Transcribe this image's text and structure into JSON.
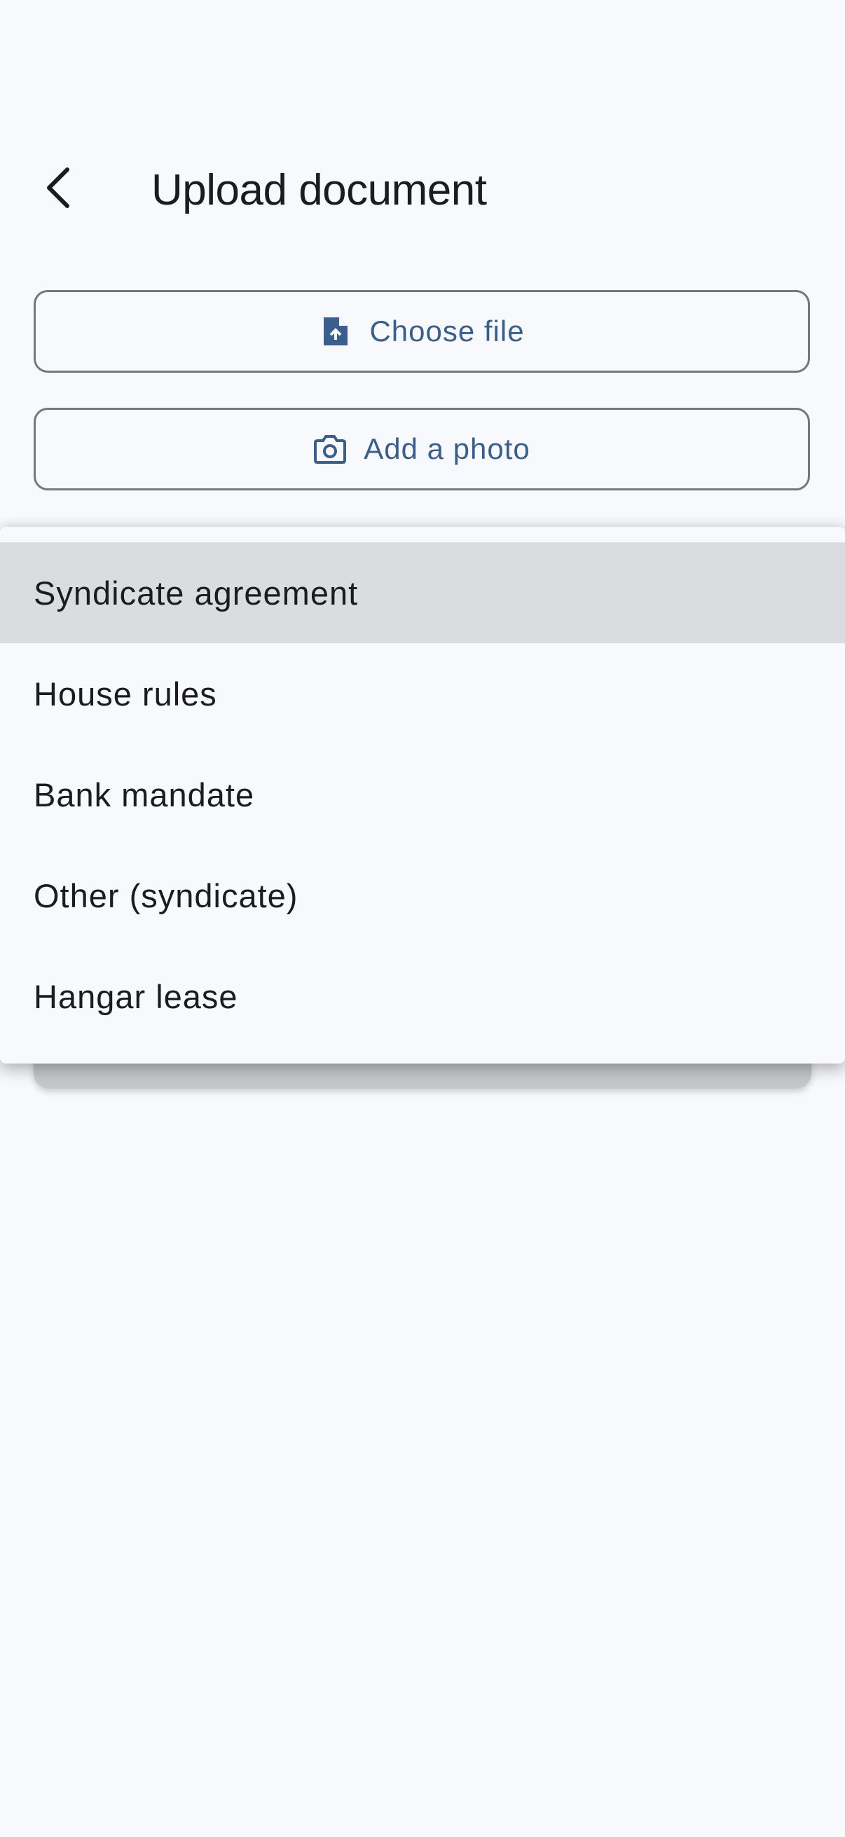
{
  "header": {
    "title": "Upload document",
    "back_icon": "chevron-left-icon"
  },
  "actions": {
    "choose_file_label": "Choose file",
    "choose_file_icon": "file-upload-icon",
    "add_photo_label": "Add a photo",
    "add_photo_icon": "camera-icon"
  },
  "dropdown": {
    "selected_index": 0,
    "options": [
      "Syndicate agreement",
      "House rules",
      "Bank mandate",
      "Other (syndicate)",
      "Hangar lease"
    ]
  },
  "colors": {
    "background": "#f8f9fd",
    "accent": "#3a5f8d",
    "outline": "#74777f",
    "selected_item": "#dbdce0"
  }
}
